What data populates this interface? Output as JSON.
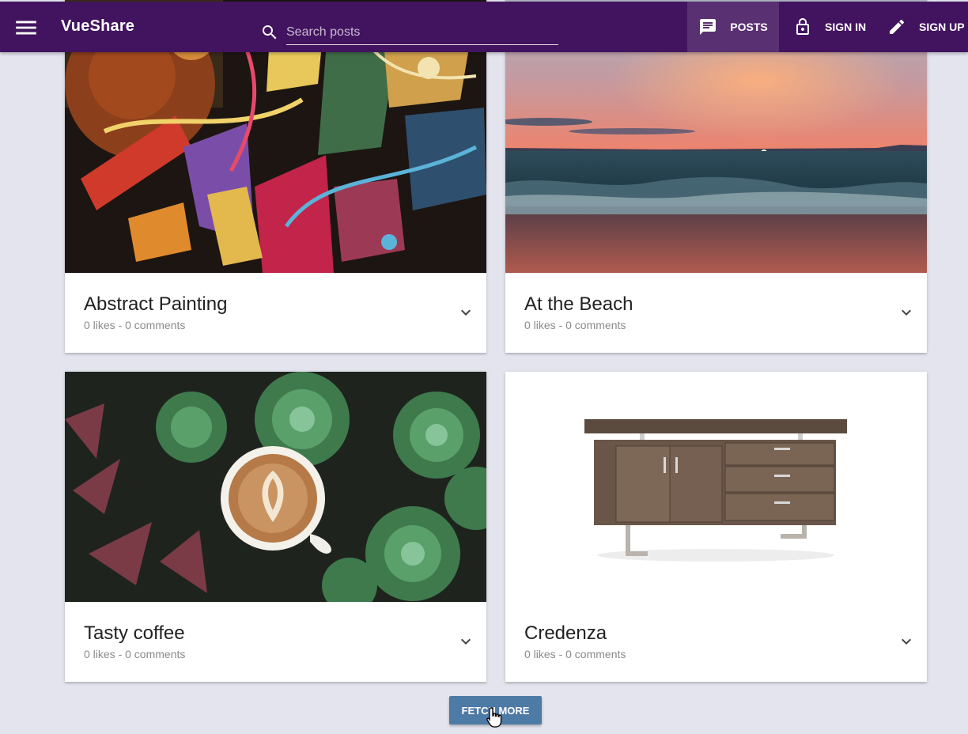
{
  "app": {
    "title": "VueShare"
  },
  "search": {
    "placeholder": "Search posts"
  },
  "nav": {
    "posts": "POSTS",
    "signin": "SIGN IN",
    "signup": "SIGN UP"
  },
  "posts": [
    {
      "title": "Abstract Painting",
      "meta": "0 likes - 0 comments"
    },
    {
      "title": "At the Beach",
      "meta": "0 likes - 0 comments"
    },
    {
      "title": "Tasty coffee",
      "meta": "0 likes - 0 comments"
    },
    {
      "title": "Credenza",
      "meta": "0 likes - 0 comments"
    }
  ],
  "actions": {
    "fetch_more": "FETCH MORE"
  },
  "colors": {
    "toolbar": "#42145f",
    "background": "#e4e4ee",
    "fetch_button": "#4e7aa6"
  }
}
